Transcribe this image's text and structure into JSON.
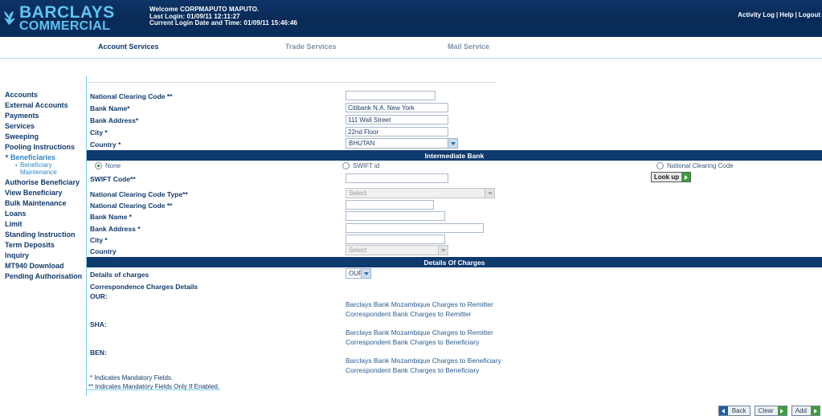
{
  "header": {
    "logo_primary": "BARCLAYS",
    "logo_secondary": "COMMERCIAL",
    "welcome": "Welcome CORPMAPUTO MAPUTO.",
    "last_login": "Last Login: 01/09/11 12:11:27",
    "current_login": "Current Login Date and Time: 01/09/11 15:46:46",
    "links": [
      "Activity Log",
      "Help",
      "Logout"
    ],
    "separator": "|"
  },
  "nav": {
    "tabs": [
      {
        "label": "Account Services",
        "active": true
      },
      {
        "label": "Trade Services",
        "active": false
      },
      {
        "label": "Mail Service",
        "active": false
      }
    ]
  },
  "sidebar": {
    "items": [
      {
        "label": "Accounts"
      },
      {
        "label": "External Accounts"
      },
      {
        "label": "Payments"
      },
      {
        "label": "Services"
      },
      {
        "label": "Sweeping"
      },
      {
        "label": "Pooling Instructions"
      },
      {
        "label": "Beneficiaries"
      },
      {
        "label": "Authorise Beneficiary"
      },
      {
        "label": "View Beneficiary"
      },
      {
        "label": "Bulk Maintenance"
      },
      {
        "label": "Loans"
      },
      {
        "label": "Limit"
      },
      {
        "label": "Standing Instruction"
      },
      {
        "label": "Term Deposits"
      },
      {
        "label": "Inquiry"
      },
      {
        "label": "MT940 Download"
      },
      {
        "label": "Pending Authorisation"
      }
    ],
    "sub_item": "Beneficiary Maintenance",
    "expand_arrow": "▼",
    "sub_bullet": "▪"
  },
  "beneficiary_bank": {
    "fields": [
      {
        "label": "National Clearing Code **",
        "value": "",
        "type": "text",
        "width": 112
      },
      {
        "label": "Bank Name*",
        "value": "Citibank N.A. New York",
        "type": "text",
        "width": 128
      },
      {
        "label": "Bank Address*",
        "value": "111 Wall Street",
        "type": "text",
        "width": 128
      },
      {
        "label": "City *",
        "value": "22nd Floor",
        "type": "text",
        "width": 128
      },
      {
        "label": "Country *",
        "value": "BHUTAN",
        "type": "select",
        "width": 140
      }
    ]
  },
  "intermediate_bank": {
    "title": "Intermediate Bank",
    "options": [
      {
        "label": "None",
        "checked": true
      },
      {
        "label": "SWIFT id",
        "checked": false
      },
      {
        "label": "National Clearing Code",
        "checked": false
      }
    ],
    "swift_code_label": "SWIFT Code**",
    "swift_code_value": "",
    "lookup_label": "Look up",
    "fields": [
      {
        "label": "National Clearing Code Type**",
        "value": "Select",
        "type": "select",
        "disabled": true,
        "width": 186
      },
      {
        "label": "National Clearing Code **",
        "value": "",
        "type": "text",
        "disabled": false,
        "width": 110
      },
      {
        "label": "Bank Name *",
        "value": "",
        "type": "text",
        "disabled": false,
        "width": 124
      },
      {
        "label": "Bank Address *",
        "value": "",
        "type": "text",
        "disabled": false,
        "width": 172
      },
      {
        "label": "City *",
        "value": "",
        "type": "text",
        "disabled": false,
        "width": 124
      },
      {
        "label": "Country",
        "value": "Select",
        "type": "select",
        "disabled": true,
        "width": 128
      }
    ]
  },
  "details_of_charges": {
    "title": "Details Of Charges",
    "select_label": "Details of charges",
    "select_value": "OUR",
    "correspondence_label": "Correspondence Charges Details",
    "groups": [
      {
        "key": "OUR:",
        "lines": [
          "Barclays Bank Mozambique Charges to Remitter",
          "Correspondent Bank Charges to Remitter"
        ]
      },
      {
        "key": "SHA:",
        "lines": [
          "Barclays Bank Mozambique Charges to Remitter",
          "Correspondent Bank Charges to Beneficiary"
        ]
      },
      {
        "key": "BEN:",
        "lines": [
          "Barclays Bank Mozambique Charges to Beneficiary",
          "Correspondent Bank Charges to Beneficiary"
        ]
      }
    ]
  },
  "footnotes": [
    "* Indicates Mandatory Fields.",
    "** Indicates Mandatory Fields Only If Enabled."
  ],
  "buttons": [
    {
      "label": "Back",
      "icon": "left-arrow-icon",
      "color": "#1d5ea8",
      "side": "left"
    },
    {
      "label": "Clear",
      "icon": "right-arrow-icon",
      "color": "#3e9b3e",
      "side": "right"
    },
    {
      "label": "Add",
      "icon": "right-arrow-icon",
      "color": "#3e9b3e",
      "side": "right"
    }
  ],
  "colors": {
    "header_blue": "#0a2f5e",
    "section_bar": "#0e3a6e",
    "logo_cyan": "#5fc4ef",
    "link_blue": "#2f86c6",
    "label_navy": "#123a6b"
  }
}
